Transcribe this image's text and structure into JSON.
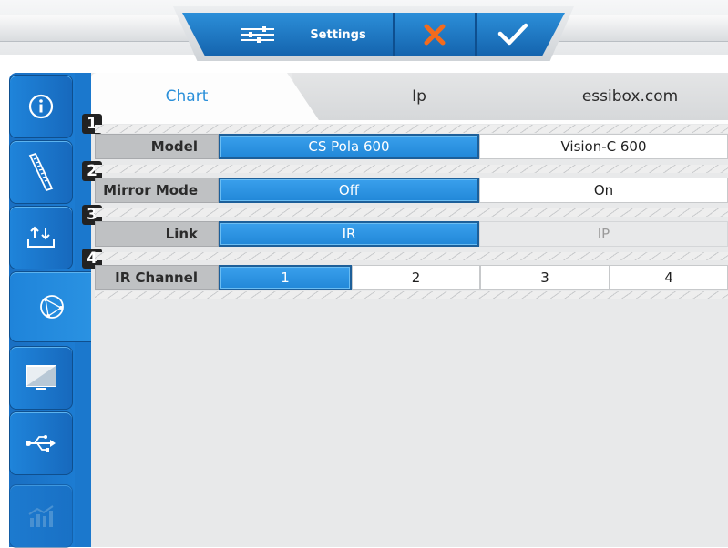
{
  "topbar": {
    "settings_icon": "sliders-icon",
    "title": "Settings",
    "cancel_icon": "close-icon",
    "confirm_icon": "check-icon"
  },
  "sidebar": {
    "items": [
      {
        "icon": "info-icon"
      },
      {
        "icon": "ruler-icon"
      },
      {
        "icon": "transfer-icon"
      },
      {
        "icon": "network-icon",
        "active": true
      },
      {
        "icon": "display-icon"
      },
      {
        "icon": "usb-icon"
      },
      {
        "icon": "statistics-icon",
        "disabled": true
      }
    ]
  },
  "tabs": [
    {
      "label": "Chart",
      "active": true
    },
    {
      "label": "Ip"
    },
    {
      "label": "essibox.com"
    }
  ],
  "rows": [
    {
      "number": "1",
      "label": "Model",
      "options": [
        {
          "label": "CS Pola 600",
          "state": "selected"
        },
        {
          "label": "Vision-C 600",
          "state": "normal"
        }
      ]
    },
    {
      "number": "2",
      "label": "Mirror Mode",
      "options": [
        {
          "label": "Off",
          "state": "selected"
        },
        {
          "label": "On",
          "state": "normal"
        }
      ]
    },
    {
      "number": "3",
      "label": "Link",
      "options": [
        {
          "label": "IR",
          "state": "selected"
        },
        {
          "label": "IP",
          "state": "disabled"
        }
      ]
    },
    {
      "number": "4",
      "label": "IR Channel",
      "options": [
        {
          "label": "1",
          "state": "selected"
        },
        {
          "label": "2",
          "state": "normal"
        },
        {
          "label": "3",
          "state": "normal"
        },
        {
          "label": "4",
          "state": "normal"
        }
      ]
    }
  ],
  "colors": {
    "accent": "#2288d8",
    "sidebar": "#1a6fc2",
    "cancel": "#f26b1d",
    "tab_active_text": "#2a8fd9"
  }
}
